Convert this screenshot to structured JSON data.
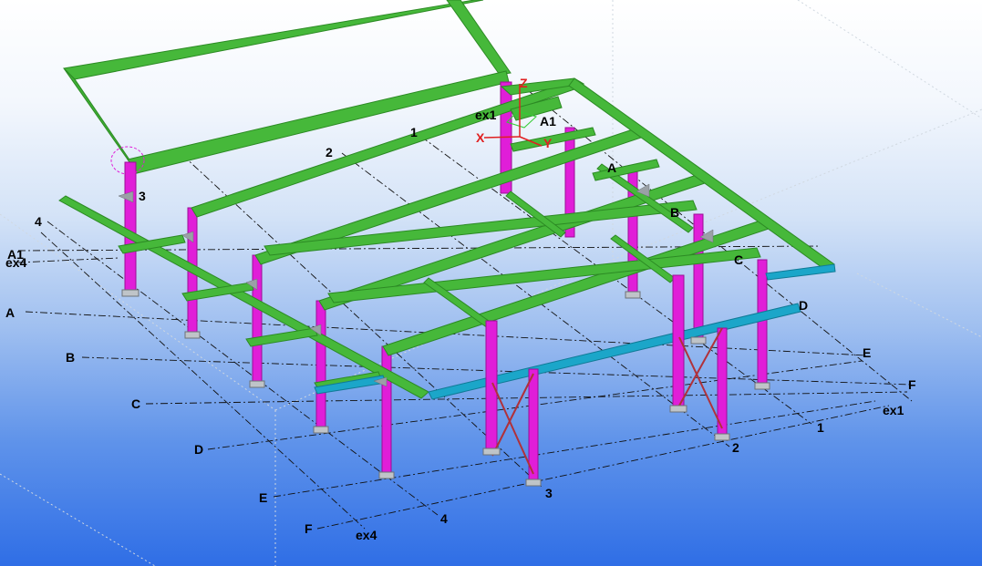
{
  "colors": {
    "column": "#e01ed8",
    "column_dark": "#9a0f95",
    "beam": "#46b83a",
    "beam_dark": "#2c8a24",
    "edge_beam": "#1ba6c9",
    "brace": "#b0313a",
    "gridline": "#111111",
    "axis_x": "#e02020",
    "axis_y": "#e02020",
    "axis_z": "#e02020"
  },
  "view_axes": {
    "x_label": "X",
    "y_label": "Y",
    "z_label": "Z"
  },
  "grid_labels": [
    {
      "id": "far-1",
      "text": "1"
    },
    {
      "id": "far-2",
      "text": "2"
    },
    {
      "id": "far-3",
      "text": "3"
    },
    {
      "id": "far-4",
      "text": "4"
    },
    {
      "id": "left-a1",
      "text": "A1"
    },
    {
      "id": "left-ex4",
      "text": "ex4"
    },
    {
      "id": "left-a",
      "text": "A"
    },
    {
      "id": "left-b",
      "text": "B"
    },
    {
      "id": "left-c",
      "text": "C"
    },
    {
      "id": "left-d",
      "text": "D"
    },
    {
      "id": "left-e",
      "text": "E"
    },
    {
      "id": "left-f",
      "text": "F"
    },
    {
      "id": "bottom-ex4",
      "text": "ex4"
    },
    {
      "id": "bottom-4",
      "text": "4"
    },
    {
      "id": "bottom-3",
      "text": "3"
    },
    {
      "id": "bottom-2",
      "text": "2"
    },
    {
      "id": "bottom-1",
      "text": "1"
    },
    {
      "id": "right-ex1",
      "text": "ex1"
    },
    {
      "id": "right-f",
      "text": "F"
    },
    {
      "id": "right-e",
      "text": "E"
    },
    {
      "id": "right-d",
      "text": "D"
    },
    {
      "id": "right-c",
      "text": "C"
    },
    {
      "id": "right-b",
      "text": "B"
    },
    {
      "id": "right-a",
      "text": "A"
    },
    {
      "id": "top-a1",
      "text": "A1"
    },
    {
      "id": "top-ex1",
      "text": "ex1"
    }
  ]
}
